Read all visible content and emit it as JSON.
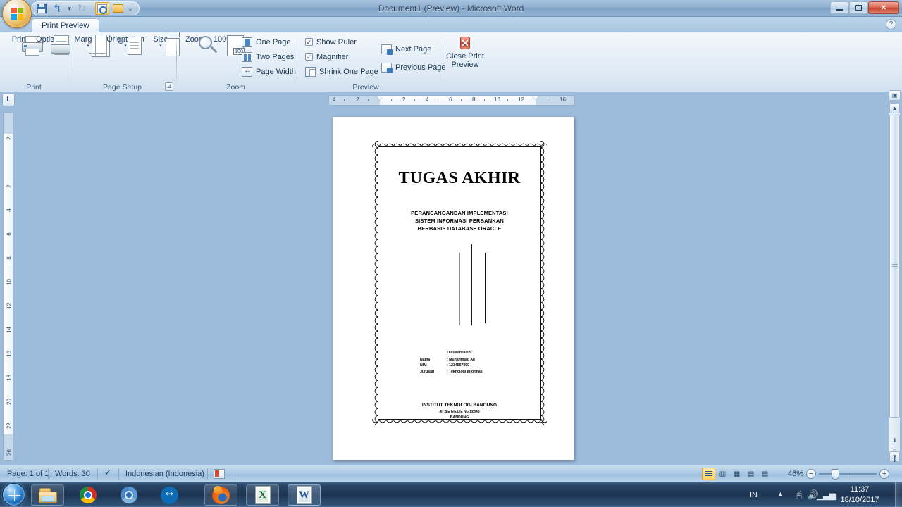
{
  "window": {
    "title": "Document1 (Preview) - Microsoft Word",
    "minimize_label": "Minimize",
    "restore_label": "Restore Down",
    "close_label": "Close",
    "help_label": "?"
  },
  "quick_access": {
    "items": [
      {
        "name": "save",
        "label": "Save"
      },
      {
        "name": "undo",
        "label": "Undo",
        "glyph": "↰"
      },
      {
        "name": "undo-dropdown",
        "label": "Undo options",
        "glyph": "▾"
      },
      {
        "name": "redo",
        "label": "Redo",
        "glyph": "↻"
      },
      {
        "name": "print-preview",
        "label": "Print Preview"
      },
      {
        "name": "open",
        "label": "Open"
      },
      {
        "name": "customize",
        "label": "Customize Quick Access Toolbar",
        "glyph": "▾"
      }
    ]
  },
  "ribbon": {
    "tab_label": "Print Preview",
    "groups": [
      {
        "name": "print",
        "label": "Print",
        "buttons": [
          {
            "name": "print",
            "label": "Print"
          },
          {
            "name": "options",
            "label": "Options"
          }
        ]
      },
      {
        "name": "page-setup",
        "label": "Page Setup",
        "buttons": [
          {
            "name": "margins",
            "label": "Margins",
            "arrow": "▾"
          },
          {
            "name": "orientation",
            "label": "Orientation",
            "arrow": "▾"
          },
          {
            "name": "size",
            "label": "Size",
            "arrow": "▾"
          }
        ],
        "launcher": "⊿"
      },
      {
        "name": "zoom",
        "label": "Zoom",
        "buttons": [
          {
            "name": "zoom",
            "label": "Zoom"
          },
          {
            "name": "zoom-100",
            "label": "100%",
            "badge": "100"
          }
        ],
        "small_buttons": [
          {
            "name": "one-page",
            "label": "One Page"
          },
          {
            "name": "two-pages",
            "label": "Two Pages"
          },
          {
            "name": "page-width",
            "label": "Page Width"
          }
        ]
      },
      {
        "name": "preview",
        "label": "Preview",
        "checkboxes": [
          {
            "name": "show-ruler",
            "label": "Show Ruler",
            "checked": true,
            "mark": "✓"
          },
          {
            "name": "magnifier",
            "label": "Magnifier",
            "checked": true,
            "mark": "✓"
          }
        ],
        "small_buttons": [
          {
            "name": "shrink-one-page",
            "label": "Shrink One Page"
          },
          {
            "name": "next-page",
            "label": "Next Page"
          },
          {
            "name": "previous-page",
            "label": "Previous Page"
          }
        ],
        "close_button": {
          "name": "close-print-preview",
          "label_line1": "Close Print",
          "label_line2": "Preview",
          "glyph": "✕"
        }
      }
    ]
  },
  "rulers": {
    "tab_selector": "L",
    "horizontal_ticks": [
      "4",
      "2",
      "2",
      "4",
      "6",
      "8",
      "10",
      "12",
      "16"
    ],
    "vertical_ticks": [
      "2",
      "2",
      "4",
      "6",
      "8",
      "10",
      "12",
      "14",
      "16",
      "18",
      "20",
      "22",
      "26"
    ]
  },
  "document": {
    "title": "TUGAS AKHIR",
    "subtitle_lines": [
      "PERANCANGANDAN IMPLEMENTASI",
      "SISTEM INFORMASI PERBANKAN",
      "BERBASIS DATABASE ORACLE"
    ],
    "author_heading": "Disusun Oleh:",
    "author_rows": [
      {
        "key": "Nama",
        "value": ": Muhammad Ali"
      },
      {
        "key": "NIM",
        "value": ": 1234567890"
      },
      {
        "key": "Jurusan",
        "value": ": Teknologi Informasi"
      }
    ],
    "institution": "INSTITUT TEKNOLOGI BANDUNG",
    "address": "Jl. Bla bla bla No.12345",
    "city": "BANDUNG"
  },
  "status_bar": {
    "page": "Page: 1 of 1",
    "words": "Words: 30",
    "language": "Indonesian (Indonesia)",
    "zoom_percent": "46%",
    "view_buttons": [
      {
        "name": "print-layout",
        "glyph": "▤",
        "selected": true
      },
      {
        "name": "full-screen-reading",
        "glyph": "▥",
        "selected": false
      },
      {
        "name": "web-layout",
        "glyph": "▦",
        "selected": false
      },
      {
        "name": "outline",
        "glyph": "▧",
        "selected": false
      },
      {
        "name": "draft",
        "glyph": "▤",
        "selected": false
      }
    ],
    "zoom_out": "−",
    "zoom_in": "+"
  },
  "taskbar": {
    "start_label": "Start",
    "items": [
      {
        "name": "file-explorer",
        "label": "Windows Explorer"
      },
      {
        "name": "google-chrome",
        "label": "Google Chrome"
      },
      {
        "name": "chromium",
        "label": "Chromium"
      },
      {
        "name": "teamviewer",
        "label": "TeamViewer"
      },
      {
        "name": "mozilla-firefox",
        "label": "Mozilla Firefox"
      },
      {
        "name": "microsoft-excel",
        "label": "Microsoft Excel"
      },
      {
        "name": "microsoft-word",
        "label": "Microsoft Word"
      }
    ],
    "tray": {
      "language": "IN",
      "show_hidden": "▲",
      "action_center": "🖰",
      "volume": "🔊",
      "network": "▮",
      "time": "11:37",
      "date": "18/10/2017"
    }
  },
  "colors": {
    "accent": "#4c86c0",
    "close_red": "#c4412c",
    "ribbon_bg": "#e3edf6",
    "workspace_bg": "#9dbbdb"
  }
}
